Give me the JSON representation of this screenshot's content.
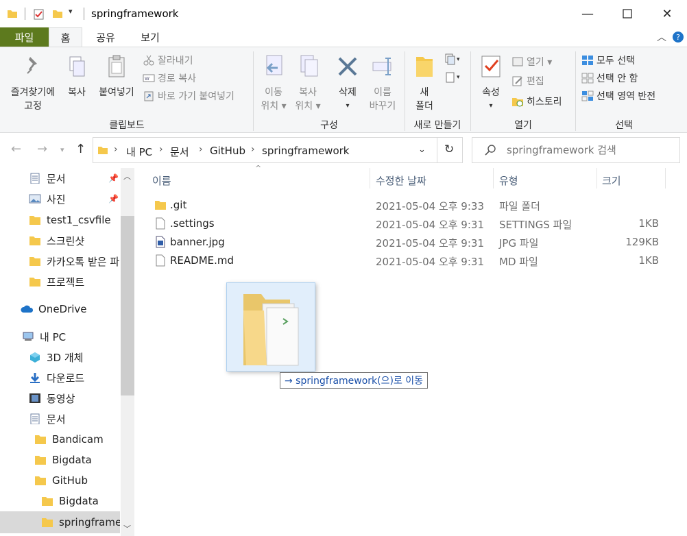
{
  "window": {
    "title": "springframework"
  },
  "ribbon_tabs": [
    "파일",
    "홈",
    "공유",
    "보기"
  ],
  "ribbon": {
    "clipboard": {
      "pin_label_1": "즐겨찾기에",
      "pin_label_2": "고정",
      "copy_label": "복사",
      "paste_label": "붙여넣기",
      "cut_label": "잘라내기",
      "copy_path_label": "경로 복사",
      "paste_shortcut_label": "바로 가기 붙여넣기",
      "group_label": "클립보드"
    },
    "organize": {
      "move_label_1": "이동",
      "move_label_2": "위치",
      "copyto_label_1": "복사",
      "copyto_label_2": "위치",
      "delete_label": "삭제",
      "rename_label_1": "이름",
      "rename_label_2": "바꾸기",
      "group_label": "구성"
    },
    "new": {
      "new_folder_label_1": "새",
      "new_folder_label_2": "폴더",
      "group_label": "새로 만들기"
    },
    "open": {
      "properties_label": "속성",
      "open_label": "열기",
      "edit_label": "편집",
      "history_label": "히스토리",
      "group_label": "열기"
    },
    "select": {
      "select_all_label": "모두 선택",
      "select_none_label": "선택 안 함",
      "invert_label": "선택 영역 반전",
      "group_label": "선택"
    }
  },
  "address": {
    "crumbs": [
      "내 PC",
      "문서",
      "GitHub",
      "springframework"
    ]
  },
  "search": {
    "placeholder": "springframework 검색"
  },
  "navpane": {
    "items": [
      "문서",
      "사진",
      "test1_csvfile",
      "스크린샷",
      "카카오톡 받은 파",
      "프로젝트",
      "OneDrive",
      "내 PC",
      "3D 개체",
      "다운로드",
      "동영상",
      "문서",
      "Bandicam",
      "Bigdata",
      "GitHub",
      "Bigdata",
      "springframework"
    ]
  },
  "columns": {
    "name": "이름",
    "modified": "수정한 날짜",
    "type": "유형",
    "size": "크기"
  },
  "files": [
    {
      "name": ".git",
      "modified": "2021-05-04 오후 9:33",
      "type": "파일 폴더",
      "size": ""
    },
    {
      "name": ".settings",
      "modified": "2021-05-04 오후 9:31",
      "type": "SETTINGS 파일",
      "size": "1KB"
    },
    {
      "name": "banner.jpg",
      "modified": "2021-05-04 오후 9:31",
      "type": "JPG 파일",
      "size": "129KB"
    },
    {
      "name": "README.md",
      "modified": "2021-05-04 오후 9:31",
      "type": "MD 파일",
      "size": "1KB"
    }
  ],
  "drag": {
    "tooltip": "→ springframework(으)로 이동"
  },
  "colors": {
    "file_tab": "#5d7a1e",
    "folder": "#f5c84c",
    "accent": "#1a4fa8"
  }
}
